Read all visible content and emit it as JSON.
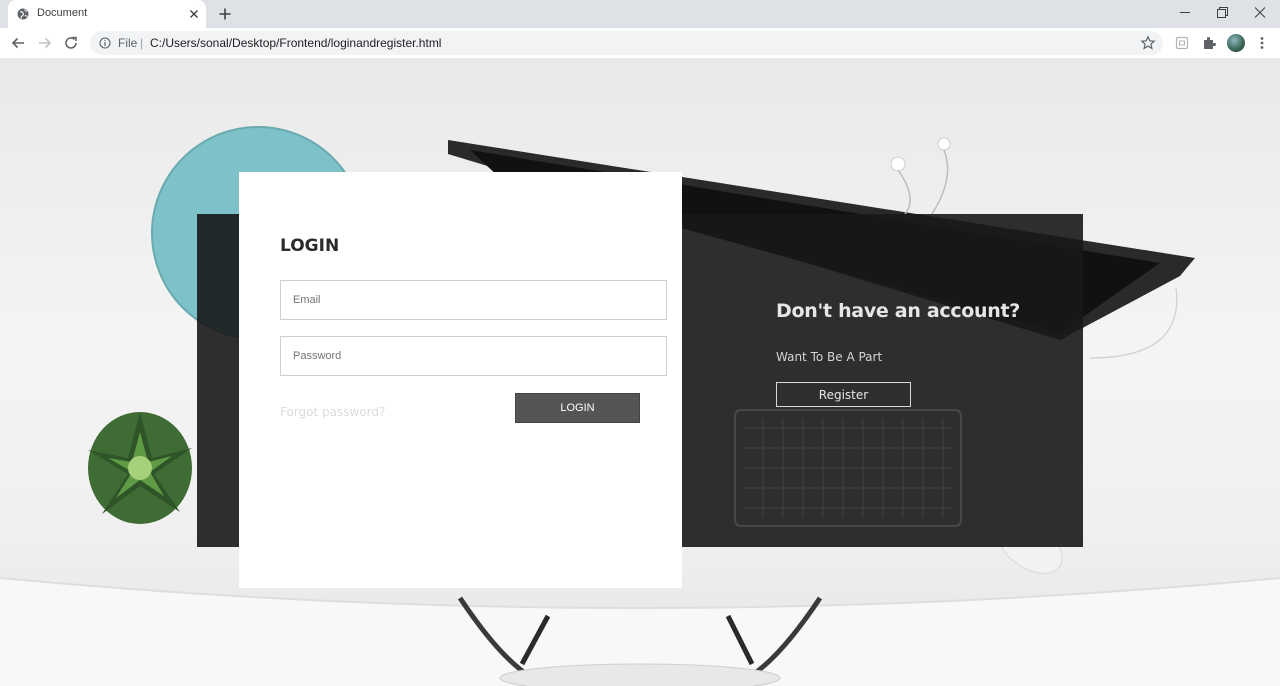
{
  "browser": {
    "tab_title": "Document",
    "new_tab_label": "+",
    "file_label": "File",
    "separator": "|",
    "url": "C:/Users/sonal/Desktop/Frontend/loginandregister.html"
  },
  "login": {
    "title": "LOGIN",
    "email_placeholder": "Email",
    "password_placeholder": "Password",
    "forgot_password": "Forgot password?",
    "login_button": "LOGIN"
  },
  "signup": {
    "title": "Don't have an account?",
    "subtitle": "Want To Be A Part",
    "register_button": "Register"
  }
}
